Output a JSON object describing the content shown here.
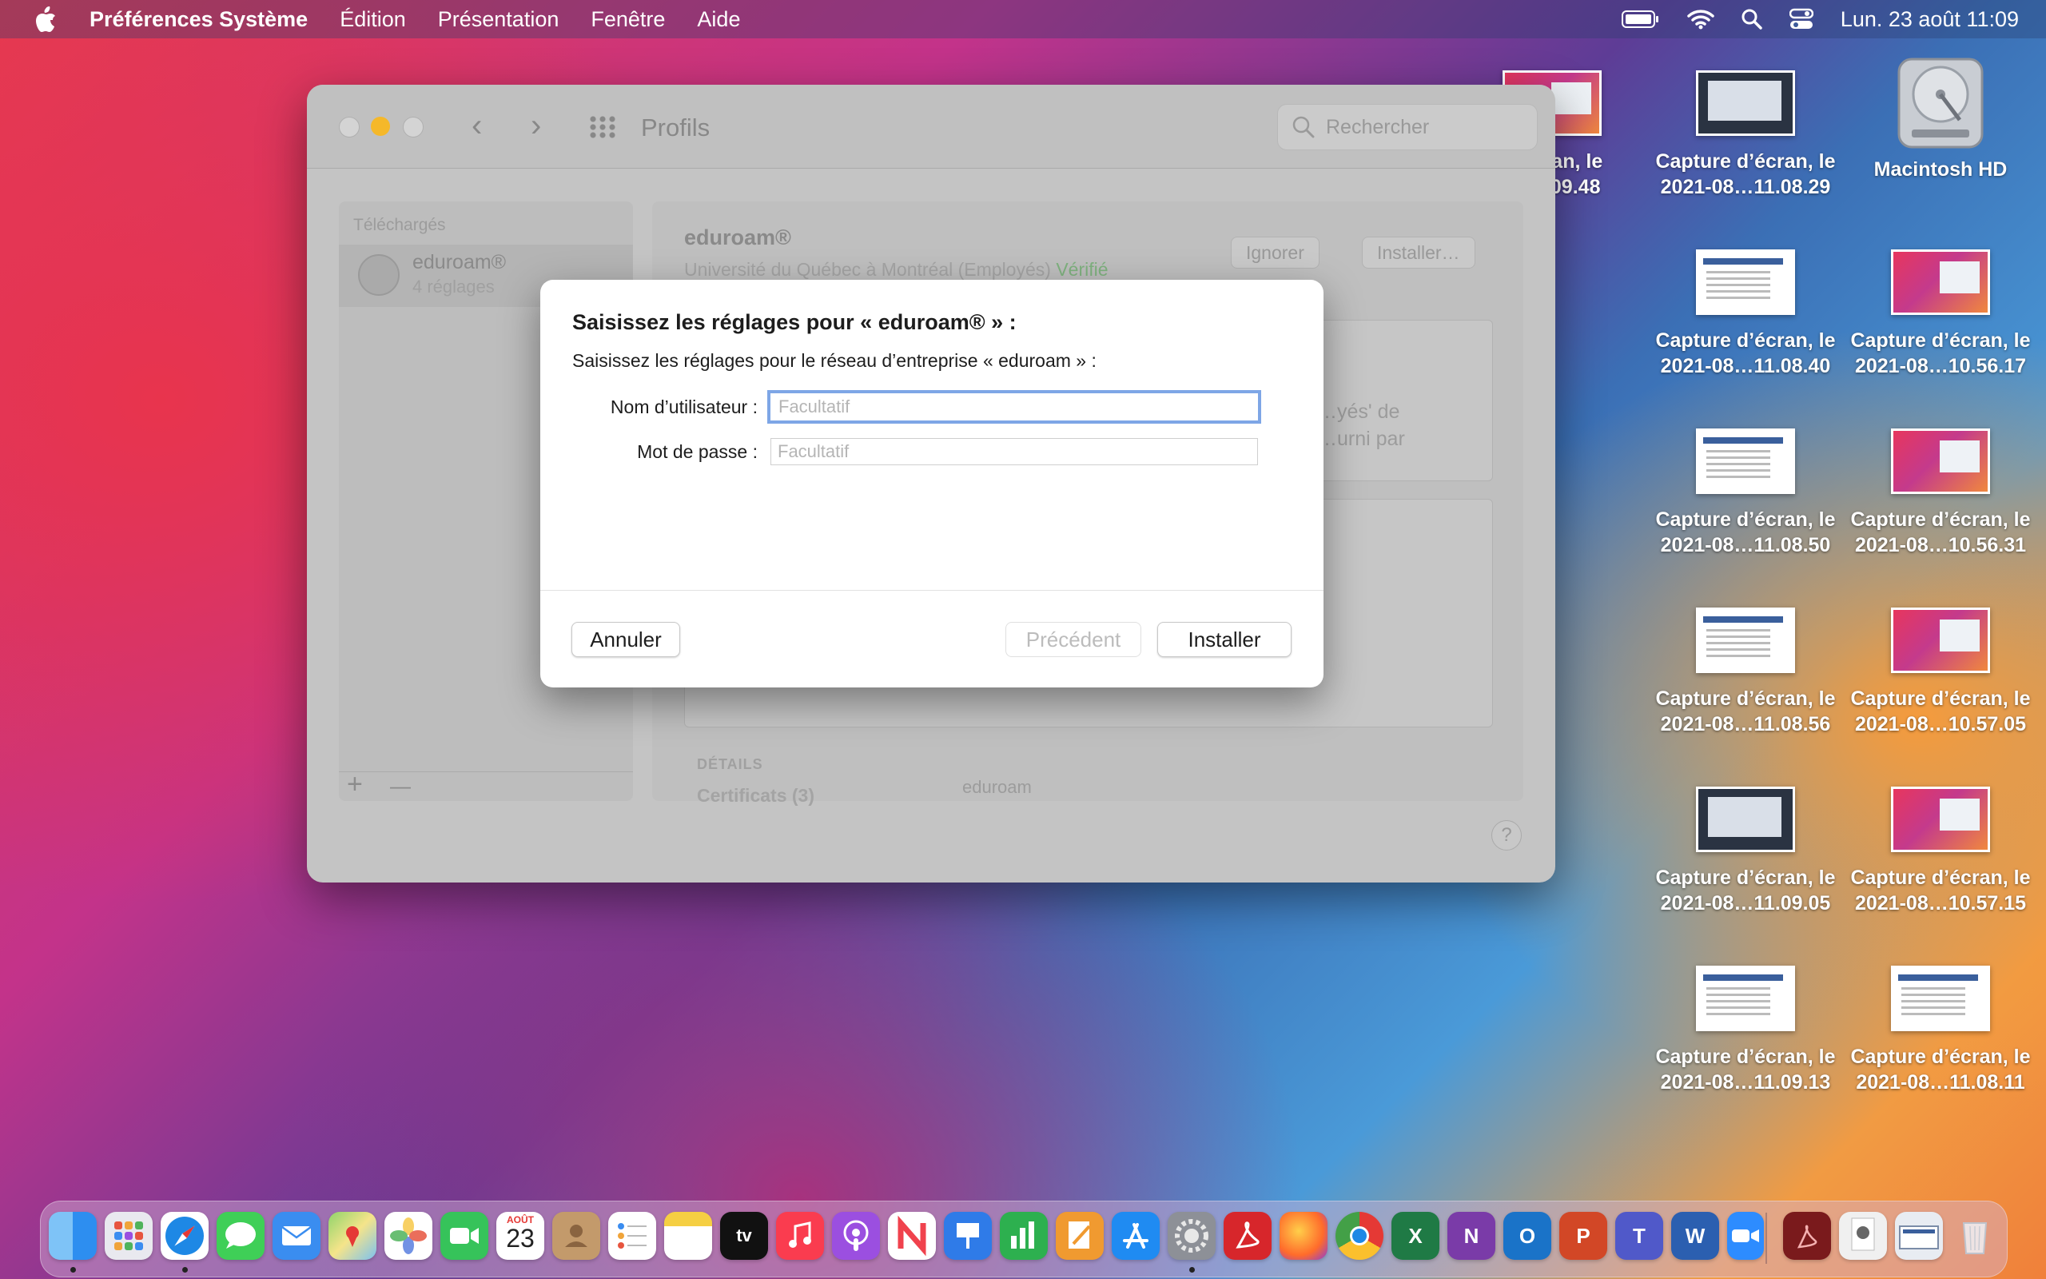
{
  "menubar": {
    "apple_icon": "apple-logo",
    "items": [
      "Préférences Système",
      "Édition",
      "Présentation",
      "Fenêtre",
      "Aide"
    ],
    "datetime": "Lun. 23 août  11:09",
    "status_icons": [
      "battery-icon",
      "wifi-icon",
      "spotlight-icon",
      "control-center-icon"
    ]
  },
  "desktop": {
    "icons": [
      {
        "label1": "…écran, le",
        "label2": "…11.09.48"
      },
      {
        "label1": "Capture d’écran, le",
        "label2": "2021-08…11.08.29"
      },
      {
        "label1": "Macintosh HD",
        "label2": ""
      },
      {
        "label1": "Capture d’écran, le",
        "label2": "2021-08…11.08.40"
      },
      {
        "label1": "Capture d’écran, le",
        "label2": "2021-08…10.56.17"
      },
      {
        "label1": "Capture d’écran, le",
        "label2": "2021-08…11.08.50"
      },
      {
        "label1": "Capture d’écran, le",
        "label2": "2021-08…10.56.31"
      },
      {
        "label1": "Capture d’écran, le",
        "label2": "2021-08…11.08.56"
      },
      {
        "label1": "Capture d’écran, le",
        "label2": "2021-08…10.57.05"
      },
      {
        "label1": "Capture d’écran, le",
        "label2": "2021-08…11.09.05"
      },
      {
        "label1": "Capture d’écran, le",
        "label2": "2021-08…10.57.15"
      },
      {
        "label1": "Capture d’écran, le",
        "label2": "2021-08…11.09.13"
      },
      {
        "label1": "Capture d’écran, le",
        "label2": "2021-08…11.08.11"
      }
    ]
  },
  "window": {
    "title": "Profils",
    "back_glyph": "‹",
    "forward_glyph": "›",
    "search_placeholder": "Rechercher",
    "sidebar": {
      "section": "Téléchargés",
      "profile_name": "eduroam®",
      "profile_sub": "4 réglages",
      "add": "+",
      "remove": "—"
    },
    "detail": {
      "name": "eduroam®",
      "org": "Université du Québec à Montréal (Employés)",
      "verified": "Vérifié",
      "ignore_button": "Ignorer",
      "install_button": "Installer…",
      "desc_line1": "…yés' de",
      "desc_line2": "…urni par",
      "footer_text": "eduroam",
      "details_label": "DÉTAILS",
      "certificates": "Certificats (3)"
    },
    "help": "?"
  },
  "sheet": {
    "title": "Saisissez les réglages pour « eduroam® » :",
    "subtitle": "Saisissez les réglages pour le réseau d’entreprise « eduroam » :",
    "username_label": "Nom d’utilisateur :",
    "username_placeholder": "Facultatif",
    "password_label": "Mot de passe :",
    "password_placeholder": "Facultatif",
    "cancel": "Annuler",
    "previous": "Précédent",
    "install": "Installer"
  },
  "dock": {
    "calendar_month": "AOÛT",
    "calendar_day": "23",
    "apps": [
      "finder-icon",
      "launchpad-icon",
      "safari-icon",
      "messages-icon",
      "mail-icon",
      "maps-icon",
      "photos-icon",
      "facetime-icon",
      "calendar-icon",
      "contacts-icon",
      "reminders-icon",
      "notes-icon",
      "apple-tv-icon",
      "music-icon",
      "podcasts-icon",
      "news-icon",
      "keynote-icon",
      "numbers-icon",
      "pages-icon",
      "app-store-icon",
      "system-preferences-icon",
      "acrobat-icon",
      "firefox-icon",
      "chrome-icon",
      "excel-icon",
      "onenote-icon",
      "outlook-icon",
      "powerpoint-icon",
      "teams-icon",
      "word-icon",
      "zoom-icon",
      "acrobat-doc-icon",
      "document-icon",
      "screenshot-doc-icon",
      "trash-icon"
    ],
    "colors": {
      "finder": "#2d8ef0",
      "safari": "#1e88e5",
      "messages": "#3fcf57",
      "mail": "#3a8df0",
      "photos": "#f7c84a",
      "facetime": "#36c35a",
      "music": "#fa3c4f",
      "podcasts": "#9b4fe0",
      "news": "#f0424d",
      "appstore": "#1f8bf2",
      "acrobat": "#d7262b",
      "excel": "#1f7a45",
      "onenote": "#7a3ba8",
      "outlook": "#1a73c8",
      "powerpoint": "#d24726",
      "teams": "#5059c9",
      "word": "#2b5fb0",
      "zoom": "#2d8cff"
    }
  }
}
